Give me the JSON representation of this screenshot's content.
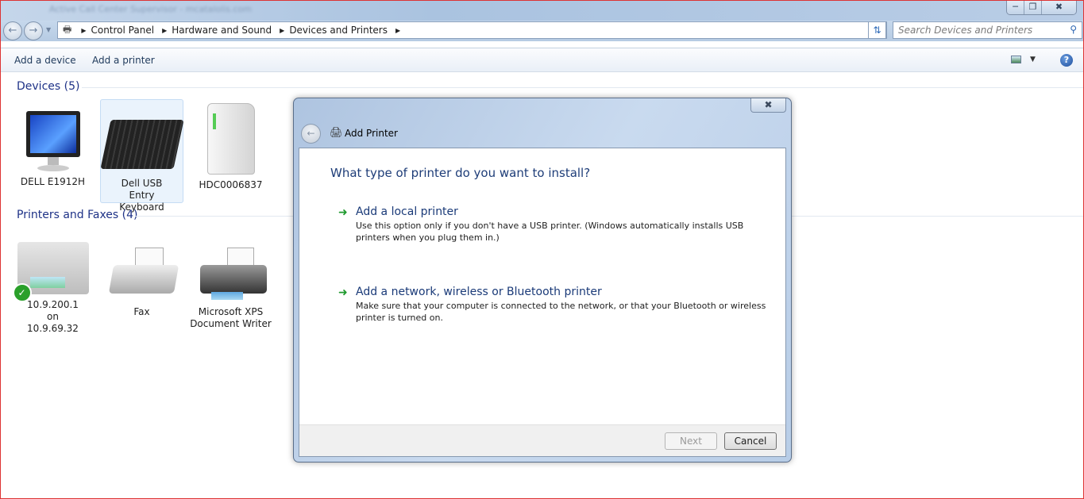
{
  "window": {
    "title_blurred": "Active Call Center Supervisor - mcatalolis.com"
  },
  "address": {
    "crumbs": [
      "Control Panel",
      "Hardware and Sound",
      "Devices and Printers"
    ]
  },
  "search": {
    "placeholder": "Search Devices and Printers"
  },
  "toolbar": {
    "add_device": "Add a device",
    "add_printer": "Add a printer"
  },
  "devices": {
    "header": "Devices (5)",
    "items": [
      {
        "label": "DELL E1912H"
      },
      {
        "label": "Dell USB Entry Keyboard",
        "selected": true
      },
      {
        "label": "HDC0006837"
      }
    ]
  },
  "printers": {
    "header": "Printers and Faxes (4)",
    "items": [
      {
        "label": "10.9.200.1 on 10.9.69.32",
        "default": true
      },
      {
        "label": "Fax"
      },
      {
        "label": "Microsoft XPS Document Writer"
      }
    ]
  },
  "dialog": {
    "title": "Add Printer",
    "question": "What type of printer do you want to install?",
    "options": [
      {
        "title": "Add a local printer",
        "desc": "Use this option only if you don't have a USB printer. (Windows automatically installs USB printers when you plug them in.)"
      },
      {
        "title": "Add a network, wireless or Bluetooth printer",
        "desc": "Make sure that your computer is connected to the network, or that your Bluetooth or wireless printer is turned on."
      }
    ],
    "next": "Next",
    "cancel": "Cancel"
  },
  "colors": {
    "link": "#1e3287",
    "dialog_heading": "#1e3d78",
    "arrow": "#1f9a2e",
    "frame": "#dd3333"
  }
}
